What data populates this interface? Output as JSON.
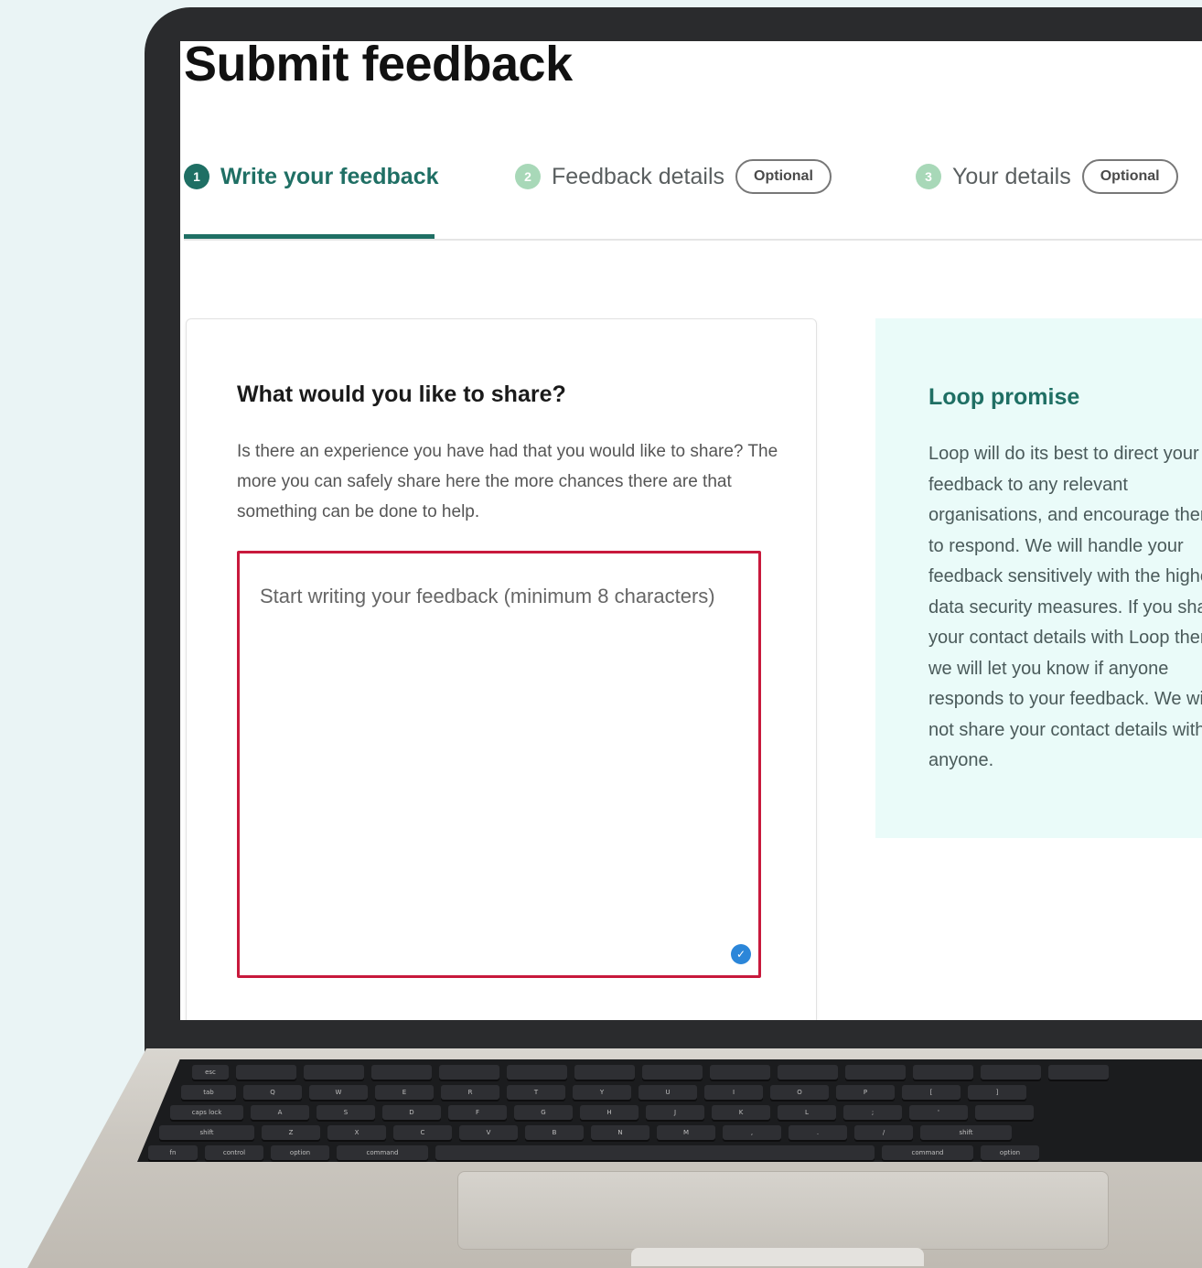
{
  "page": {
    "title": "Submit feedback"
  },
  "steps": [
    {
      "number": "1",
      "label": "Write your feedback",
      "badge": "",
      "color": "#1f6f64"
    },
    {
      "number": "2",
      "label": "Feedback details",
      "badge": "Optional",
      "color": "#a8d8b8"
    },
    {
      "number": "3",
      "label": "Your details",
      "badge": "Optional",
      "color": "#a8d8b8"
    }
  ],
  "feedback": {
    "heading": "What would you like to share?",
    "description": "Is there an experience you have had that you would like to share? The more you can safely share here the more chances there are that something can be done to help.",
    "placeholder": "Start writing your feedback (minimum 8 characters)",
    "value": ""
  },
  "promise": {
    "heading": "Loop promise",
    "text": "Loop will do its best to direct your feedback to any relevant organisations, and encourage them to respond. We will handle your feedback sensitively with the highest data security measures. If you share your contact details with Loop then we will let you know if anyone responds to your feedback. We will not share your contact details with anyone."
  },
  "colors": {
    "accent": "#1f6f64",
    "error": "#c8193c",
    "panel": "#eafbf9"
  }
}
